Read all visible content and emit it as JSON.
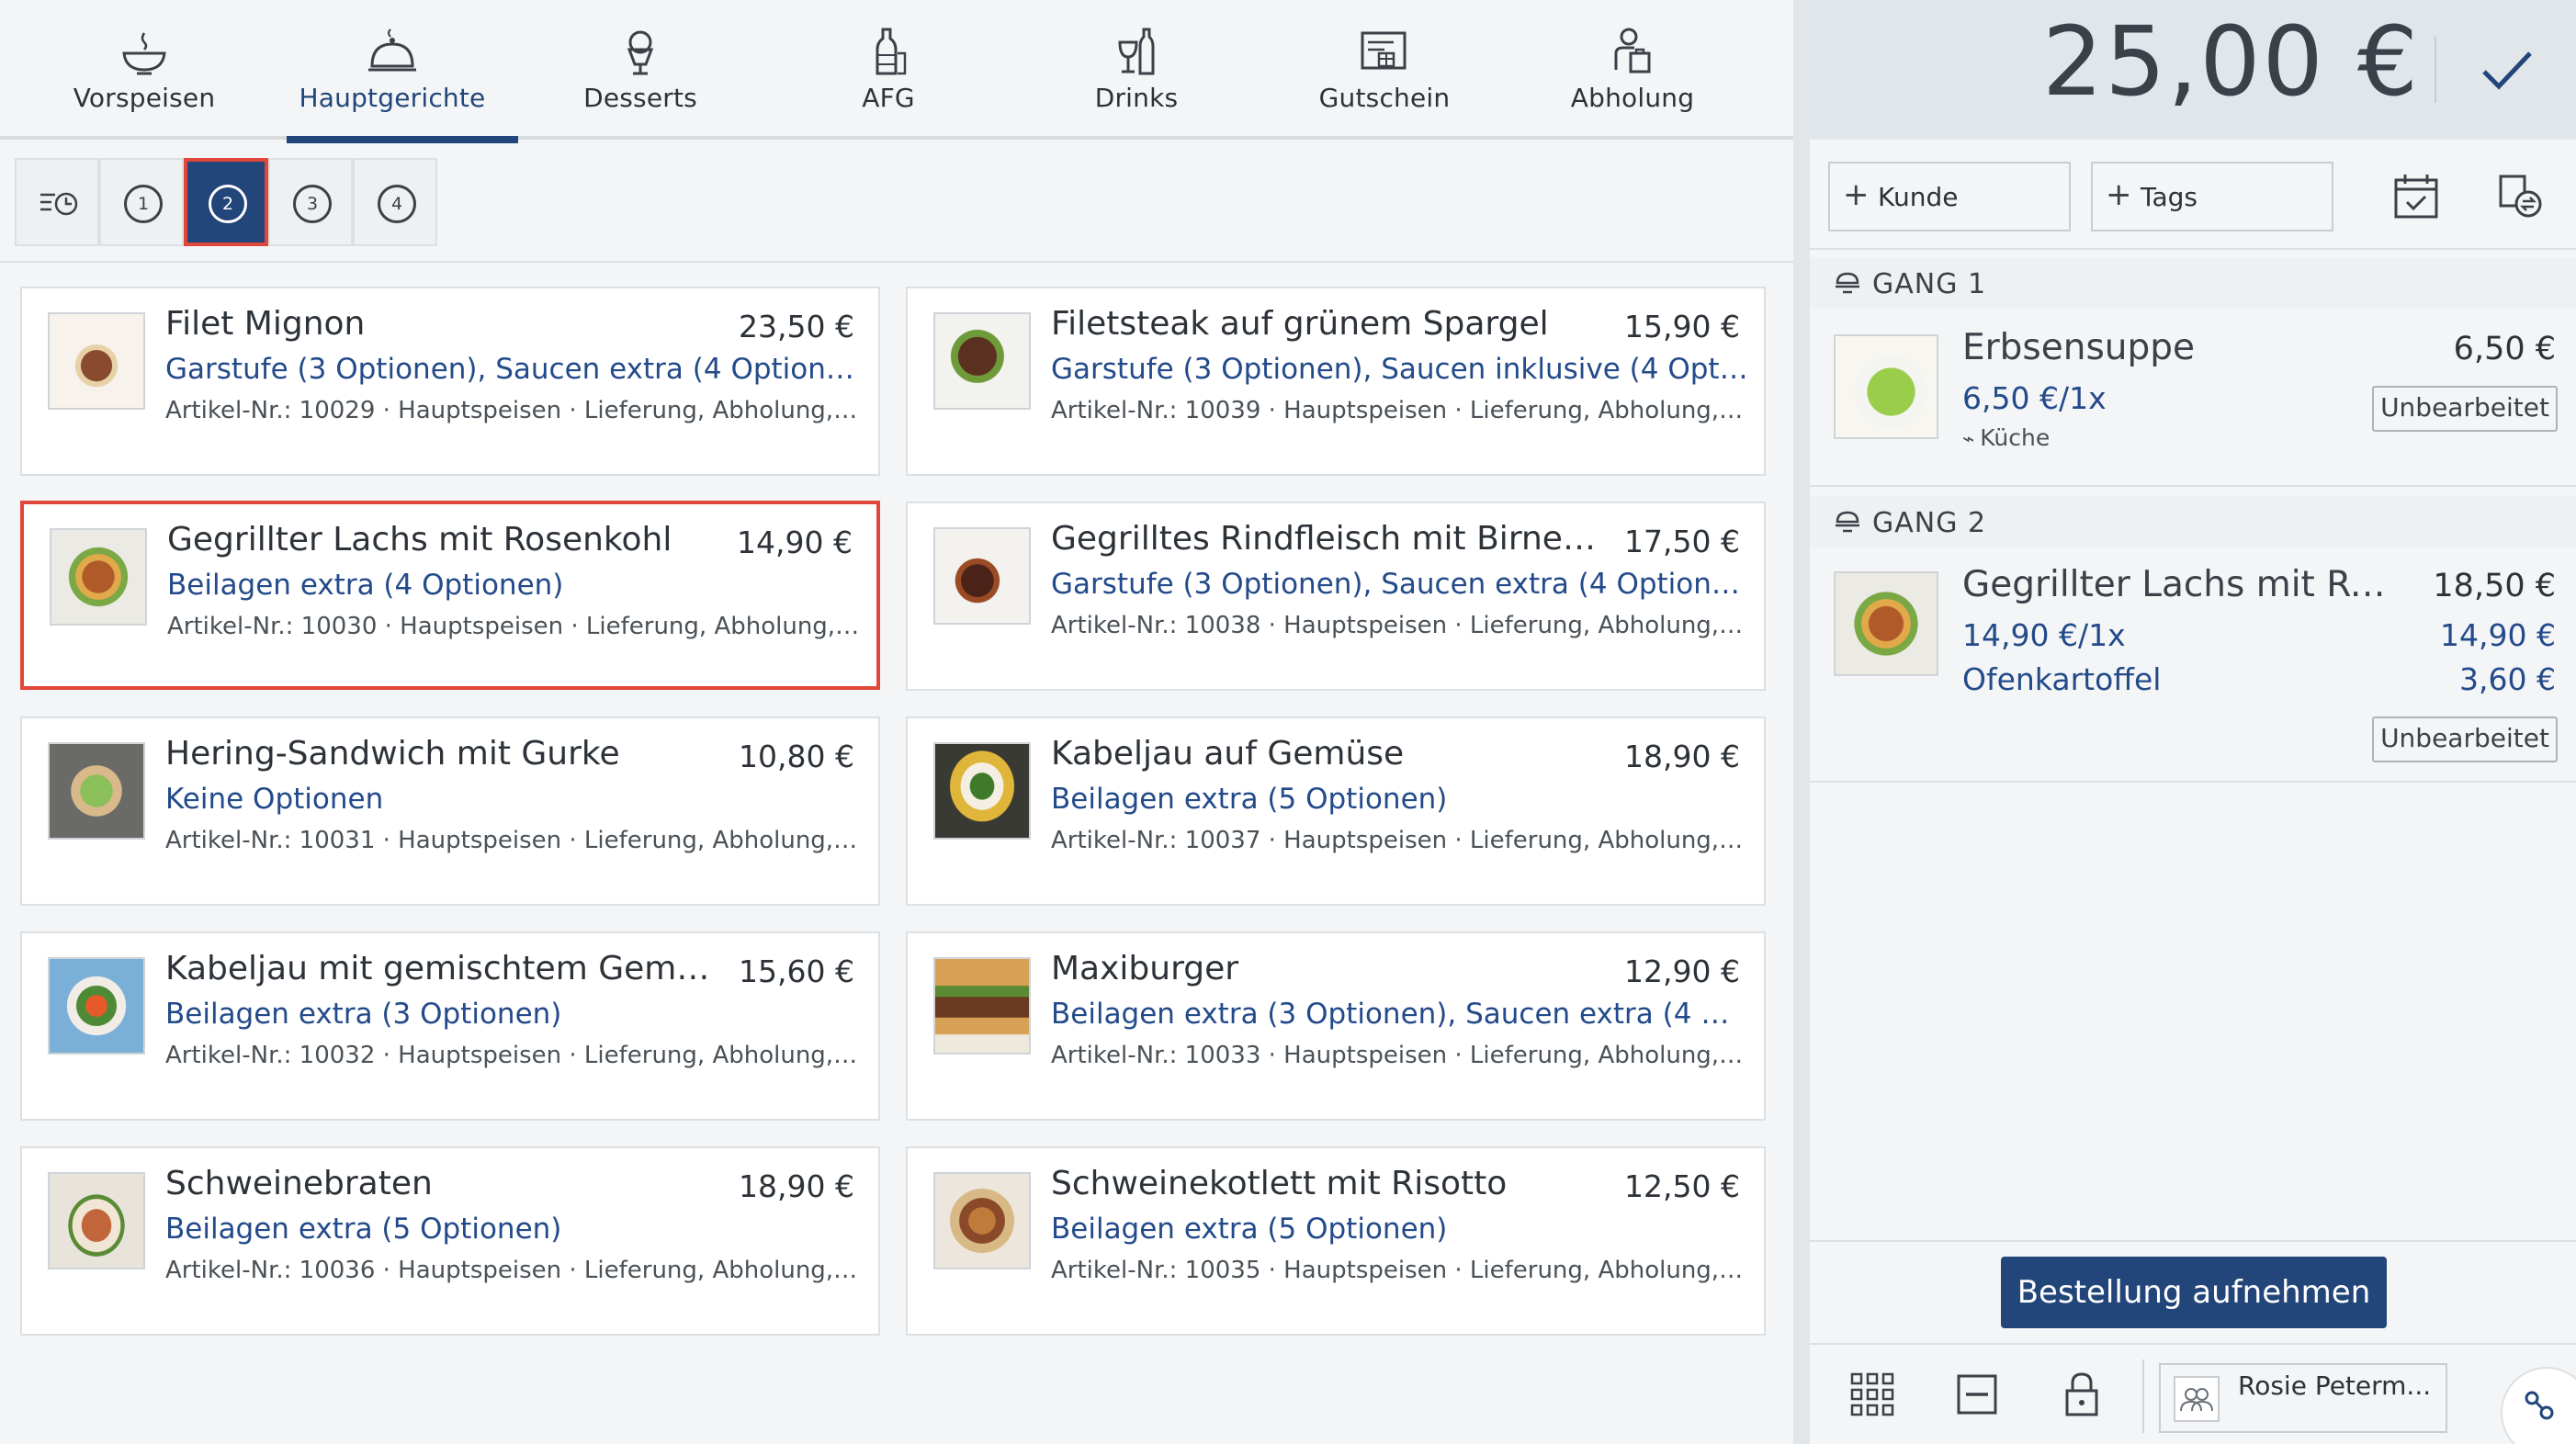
{
  "categories": [
    {
      "label": "Vorspeisen",
      "icon": "soup-bowl-icon",
      "active": false
    },
    {
      "label": "Hauptgerichte",
      "icon": "cloche-icon",
      "active": true
    },
    {
      "label": "Desserts",
      "icon": "ice-cream-icon",
      "active": false
    },
    {
      "label": "AFG",
      "icon": "bottle-icon",
      "active": false
    },
    {
      "label": "Drinks",
      "icon": "wine-glass-icon",
      "active": false
    },
    {
      "label": "Gutschein",
      "icon": "voucher-icon",
      "active": false
    },
    {
      "label": "Abholung",
      "icon": "pickup-icon",
      "active": false
    }
  ],
  "courses": {
    "sort_icon": "sort-clock-icon",
    "items": [
      "1",
      "2",
      "3",
      "4"
    ],
    "active": "2"
  },
  "products": [
    {
      "name": "Filet Mignon",
      "price": "23,50 €",
      "options": "Garstufe (3 Optionen), Saucen extra (4 Optionen), B...",
      "meta": "Artikel-Nr.: 10029 · Hauptspeisen · Lieferung, Abholung, Di..."
    },
    {
      "name": "Filetsteak auf grünem Spargel",
      "price": "15,90 €",
      "options": "Garstufe (3 Optionen), Saucen inklusive (4 Optionen...",
      "meta": "Artikel-Nr.: 10039 · Hauptspeisen · Lieferung, Abholung, Di..."
    },
    {
      "name": "Gegrillter Lachs mit Rosenkohl",
      "price": "14,90 €",
      "options": "Beilagen extra (4 Optionen)",
      "meta": "Artikel-Nr.: 10030 · Hauptspeisen · Lieferung, Abholung, Di..."
    },
    {
      "name": "Gegrilltes Rindfleisch mit Birne und F...",
      "price": "17,50 €",
      "options": "Garstufe (3 Optionen), Saucen extra (4 Optionen), B...",
      "meta": "Artikel-Nr.: 10038 · Hauptspeisen · Lieferung, Abholung, Di..."
    },
    {
      "name": "Hering-Sandwich mit Gurke",
      "price": "10,80 €",
      "options": "Keine Optionen",
      "meta": "Artikel-Nr.: 10031 · Hauptspeisen · Lieferung, Abholung, Di..."
    },
    {
      "name": "Kabeljau auf Gemüse",
      "price": "18,90 €",
      "options": "Beilagen extra (5 Optionen)",
      "meta": "Artikel-Nr.: 10037 · Hauptspeisen · Lieferung, Abholung, Di..."
    },
    {
      "name": "Kabeljau mit gemischtem Gemüse",
      "price": "15,60 €",
      "options": "Beilagen extra (3 Optionen)",
      "meta": "Artikel-Nr.: 10032 · Hauptspeisen · Lieferung, Abholung, Di..."
    },
    {
      "name": "Maxiburger",
      "price": "12,90 €",
      "options": "Beilagen extra (3 Optionen), Saucen extra (4 Option...",
      "meta": "Artikel-Nr.: 10033 · Hauptspeisen · Lieferung, Abholung, Di..."
    },
    {
      "name": "Schweinebraten",
      "price": "18,90 €",
      "options": "Beilagen extra (5 Optionen)",
      "meta": "Artikel-Nr.: 10036 · Hauptspeisen · Lieferung, Abholung, Di..."
    },
    {
      "name": "Schweinekotlett mit Risotto",
      "price": "12,50 €",
      "options": "Beilagen extra (5 Optionen)",
      "meta": "Artikel-Nr.: 10035 · Hauptspeisen · Lieferung, Abholung, Di..."
    }
  ],
  "selected_product": "Gegrillter Lachs mit Rosenkohl",
  "order": {
    "total": "25,00 €",
    "customer_button": "Kunde",
    "tags_button": "Tags",
    "gang1": {
      "label": "GANG 1",
      "item": {
        "name": "Erbsensuppe",
        "price": "6,50 €",
        "unit": "6,50 €/1x",
        "station": "Küche",
        "status": "Unbearbeitet"
      }
    },
    "gang2": {
      "label": "GANG 2",
      "item": {
        "name": "Gegrillter Lachs mit Rose...",
        "price": "18,50 €",
        "unit": "14,90 €/1x",
        "unit_price": "14,90 €",
        "extra": "Ofenkartoffel",
        "extra_price": "3,60 €",
        "status": "Unbearbeitet"
      }
    },
    "place_order": "Bestellung aufnehmen",
    "staff_name": "Rosie Peterm..."
  },
  "colors": {
    "accent": "#22467a",
    "selection": "#e0463a",
    "link": "#234a8a",
    "background": "#f4f5f6"
  }
}
